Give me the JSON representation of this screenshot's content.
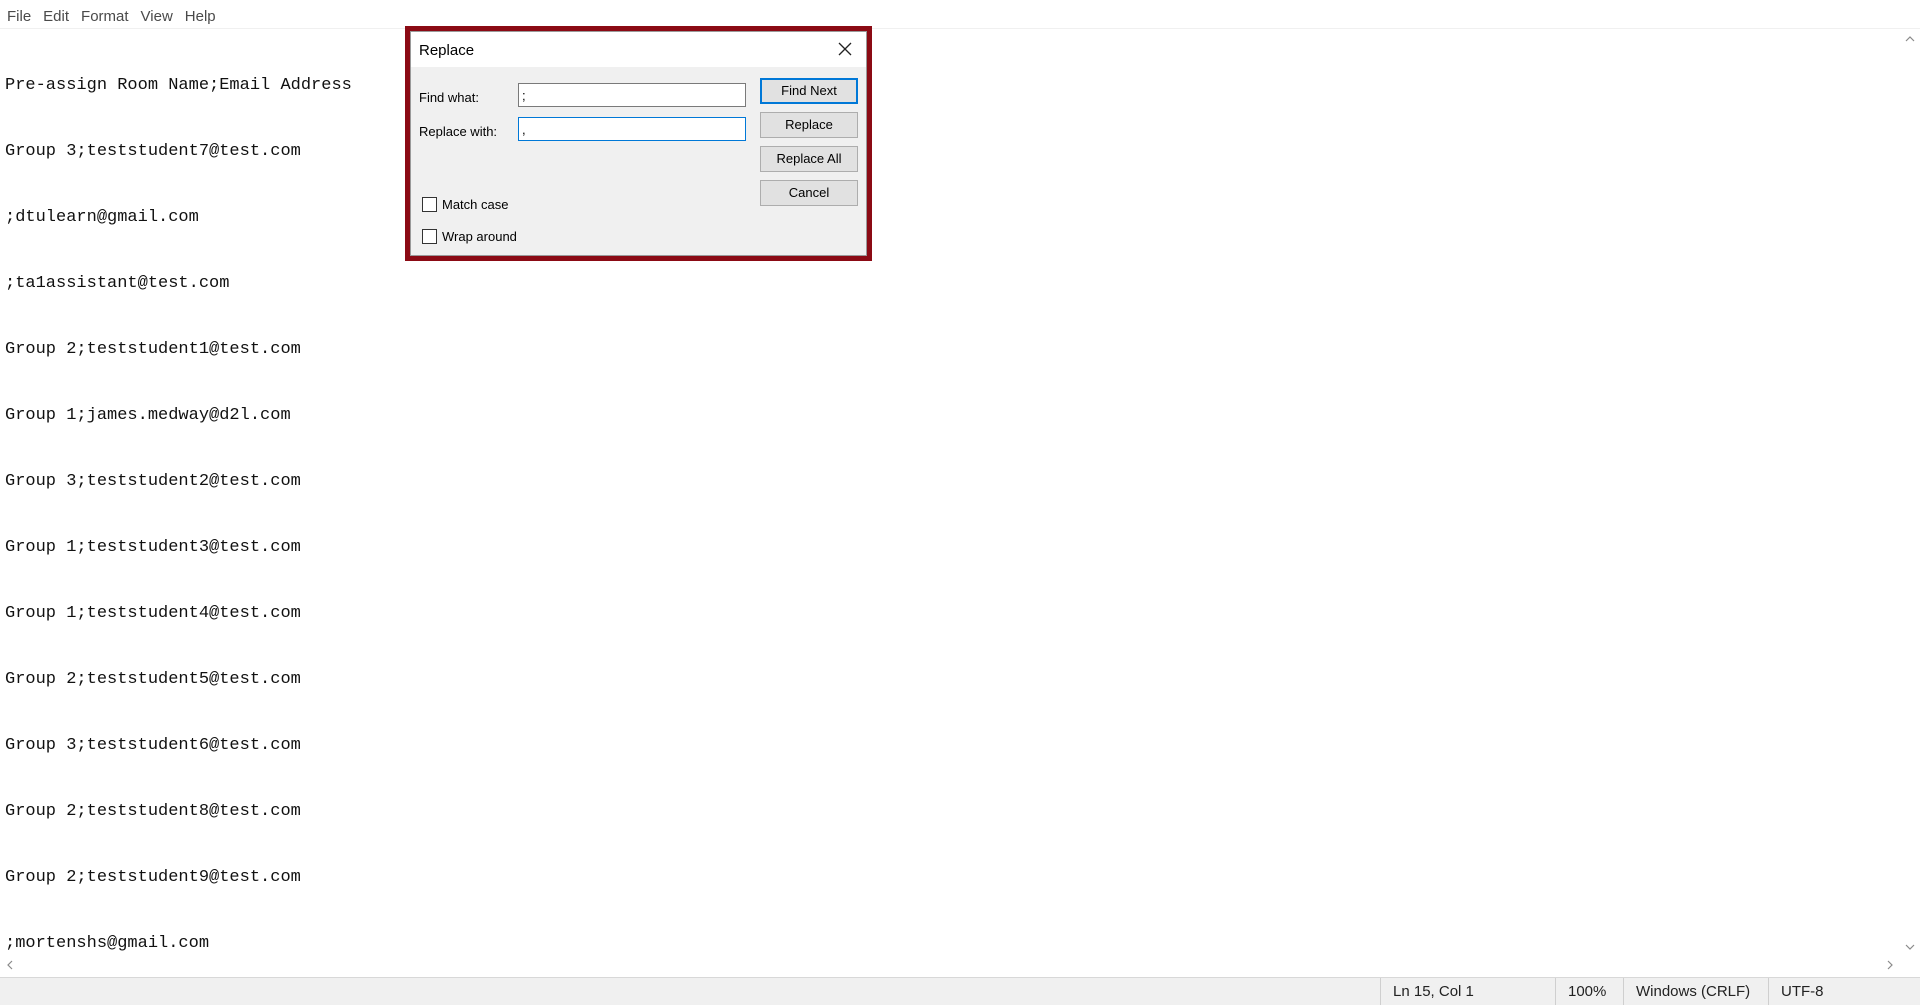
{
  "menu": {
    "items": [
      "File",
      "Edit",
      "Format",
      "View",
      "Help"
    ]
  },
  "editor": {
    "lines": [
      "Pre-assign Room Name;Email Address",
      "Group 3;teststudent7@test.com",
      ";dtulearn@gmail.com",
      ";ta1assistant@test.com",
      "Group 2;teststudent1@test.com",
      "Group 1;james.medway@d2l.com",
      "Group 3;teststudent2@test.com",
      "Group 1;teststudent3@test.com",
      "Group 1;teststudent4@test.com",
      "Group 2;teststudent5@test.com",
      "Group 3;teststudent6@test.com",
      "Group 2;teststudent8@test.com",
      "Group 2;teststudent9@test.com",
      ";mortenshs@gmail.com"
    ]
  },
  "dialog": {
    "title": "Replace",
    "find_label": "Find what:",
    "find_value": ";",
    "replace_label": "Replace with:",
    "replace_value": ",",
    "buttons": {
      "find_next": "Find Next",
      "replace": "Replace",
      "replace_all": "Replace All",
      "cancel": "Cancel"
    },
    "match_case_label": "Match case",
    "wrap_around_label": "Wrap around",
    "highlight_color": "#8b0a14"
  },
  "status": {
    "position": "Ln 15, Col 1",
    "zoom": "100%",
    "line_ending": "Windows (CRLF)",
    "encoding": "UTF-8"
  },
  "icons": {
    "close": "close-icon",
    "scroll_up": "chevron-up-icon",
    "scroll_down": "chevron-down-icon",
    "scroll_left": "chevron-left-icon",
    "scroll_right": "chevron-right-icon"
  }
}
